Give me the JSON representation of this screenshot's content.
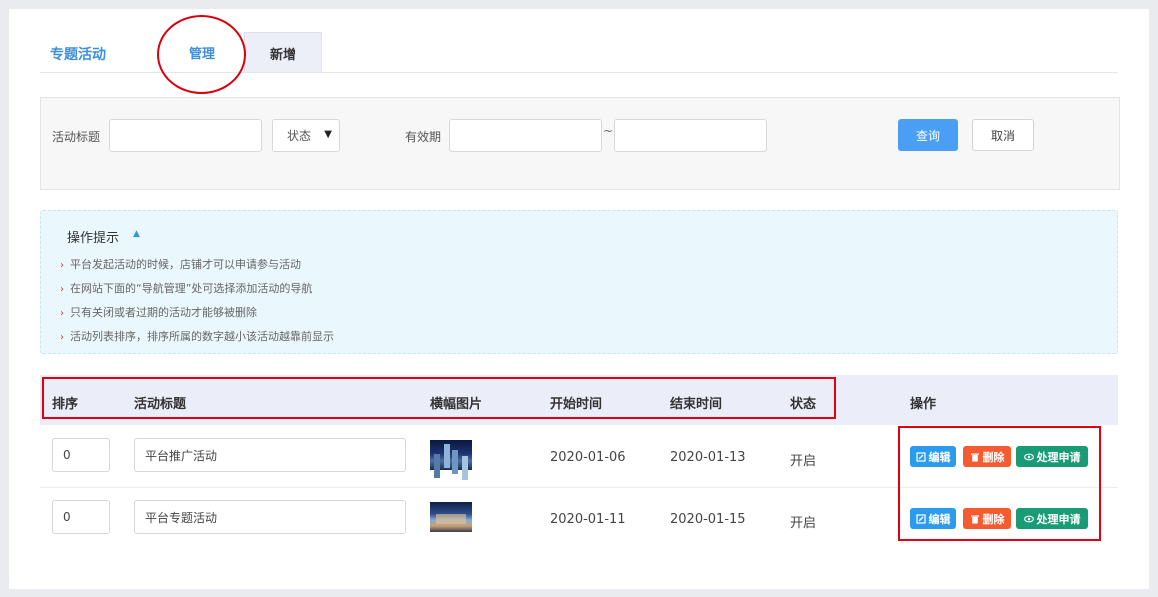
{
  "header": {
    "title": "专题活动",
    "tabs": [
      {
        "label": "管理",
        "active": true
      },
      {
        "label": "新增",
        "active": false
      }
    ]
  },
  "search": {
    "title_label": "活动标题",
    "title_value": "",
    "status_select": "状态",
    "period_label": "有效期",
    "separator": "~",
    "query_button": "查询",
    "cancel_button": "取消"
  },
  "tips": {
    "title": "操作提示",
    "items": [
      "平台发起活动的时候，店铺才可以申请参与活动",
      "在网站下面的“导航管理”处可选择添加活动的导航",
      "只有关闭或者过期的活动才能够被删除",
      "活动列表排序，排序所属的数字越小该活动越靠前显示"
    ]
  },
  "table": {
    "columns": [
      "排序",
      "活动标题",
      "横幅图片",
      "开始时间",
      "结束时间",
      "状态",
      "操作"
    ],
    "rows": [
      {
        "sort": "0",
        "title": "平台推广活动",
        "start": "2020-01-06",
        "end": "2020-01-13",
        "status": "开启"
      },
      {
        "sort": "0",
        "title": "平台专题活动",
        "start": "2020-01-11",
        "end": "2020-01-15",
        "status": "开启"
      }
    ],
    "actions": {
      "edit": "编辑",
      "delete": "删除",
      "process": "处理申请"
    }
  },
  "colors": {
    "accent": "#3d8fd9",
    "edit": "#2d9bec",
    "delete": "#f45b31",
    "process": "#199b76",
    "annotation": "#e00012"
  }
}
